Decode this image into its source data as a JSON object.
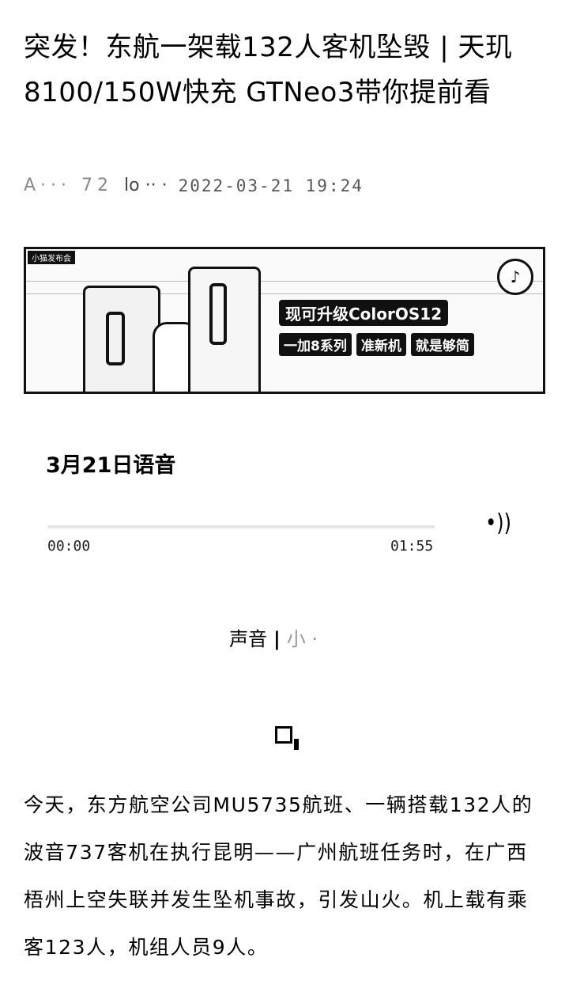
{
  "article": {
    "title": "突发！东航一架载132人客机坠毁 | 天玑8100/150W快充 GTNeo3带你提前看",
    "meta": {
      "author": "A··· 72",
      "account": "lo ·· ·",
      "date": "2022-03-21 19:24"
    }
  },
  "banner": {
    "tag": "小猫发布会",
    "headline1": "现可升级ColorOS12",
    "headline2_a": "一加8系列",
    "headline2_b": "准新机",
    "headline2_c": "就是够简",
    "logo_icon": "music-note-logo-icon"
  },
  "audio": {
    "title": "3月21日语音",
    "time_start": "00:00",
    "time_end": "01:55",
    "progress": 0,
    "source_label": "声音",
    "source_sep": "|",
    "source_name": "小 ·"
  },
  "body": {
    "paragraph": "今天，东方航空公司MU5735航班、一辆搭载132人的波音737客机在执行昆明——广州航班任务时，在广西梧州上空失联并发生坠机事故，引发山火。机上载有乘客123人，机组人员9人。"
  },
  "colors": {
    "text": "#000000",
    "muted": "#888888",
    "background": "#ffffff"
  }
}
